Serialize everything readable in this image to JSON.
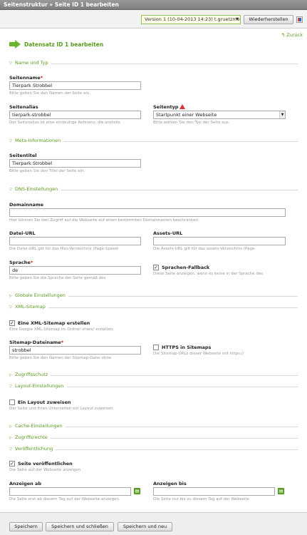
{
  "window": {
    "title": "Seitenstruktur » Seite ID 1 bearbeiten"
  },
  "toolbar": {
    "version_value": "Version 1 (10-04-2013 14:23) t.gruetzmer",
    "restore_label": "Wiederherstellen",
    "compare_icon": "diff-icon"
  },
  "back_label": "Zurück",
  "page_heading": "Datensatz ID 1 bearbeiten",
  "sections": {
    "name_typ": "Name und Typ",
    "meta": "Meta-Informationen",
    "dns": "DNS-Einstellungen",
    "global": "Globale Einstellungen",
    "xml": "XML-Sitemap",
    "zugriffsschutz": "Zugriffsschutz",
    "layout": "Layout-Einstellungen",
    "cache": "Cache-Einstellungen",
    "zugriffsrechte": "Zugriffsrechte",
    "veroeffentlichung": "Veröffentlichung"
  },
  "fields": {
    "seitenname": {
      "label": "Seitenname",
      "value": "Tierpark Strobbel",
      "hint": "Bitte geben Sie den Namen der Seite ein."
    },
    "seitenalias": {
      "label": "Seitenalias",
      "value": "tierpark-strobbel",
      "hint": "Der Seitenalias ist eine eindeutige Referenz, die anstelle"
    },
    "seitentyp": {
      "label": "Seitentyp",
      "value": "Startpunkt einer Webseite",
      "hint": "Bitte wählen Sie den Typ der Seite aus."
    },
    "seitentitel": {
      "label": "Seitentitel",
      "value": "Tierpark Strobbel",
      "hint": "Bitte geben Sie den Titel der Seite ein."
    },
    "domainname": {
      "label": "Domainname",
      "value": "",
      "hint": "Hier können Sie den Zugriff auf die Webseite auf einen bestimmten Domainnamen beschränken."
    },
    "datei_url": {
      "label": "Datei-URL",
      "value": "",
      "hint": "Die Datei-URL gilt für das files-Verzeichnis (Page-Speed-"
    },
    "assets_url": {
      "label": "Assets-URL",
      "value": "",
      "hint": "Die Assets-URL gilt für das assets-Verzeichnis (Page-"
    },
    "sprache": {
      "label": "Sprache",
      "value": "de",
      "hint": "Bitte geben Sie die Sprache der Seite gemäß des"
    },
    "sprachen_fallback": {
      "label": "Sprachen-Fallback",
      "checked": true,
      "hint": "Diese Seite anzeigen, wenn es keine in der Sprache des"
    },
    "xml_sitemap": {
      "label": "Eine XML-Sitemap erstellen",
      "checked": true,
      "hint": "Eine Google XML-Sitemap im Ordner share/ erstellen."
    },
    "sitemap_name": {
      "label": "Sitemap-Dateiname",
      "value": "strobbel",
      "hint": "Bitte geben Sie den Namen der Sitemap-Datei ohne"
    },
    "https_sitemap": {
      "label": "HTTPS in Sitemaps",
      "checked": false,
      "hint": "Die Sitemap-URLs dieser Webseite mit https://"
    },
    "layout_zuweisen": {
      "label": "Ein Layout zuweisen",
      "checked": false,
      "hint": "Der Seite und ihren Unterseiten ein Layout zuweisen."
    },
    "seite_veroeffentlichen": {
      "label": "Seite veröffentlichen",
      "checked": true,
      "hint": "Die Seite auf der Webseite anzeigen."
    },
    "anzeigen_ab": {
      "label": "Anzeigen ab",
      "value": "",
      "hint": "Die Seite erst ab diesem Tag auf der Webseite anzeigen."
    },
    "anzeigen_bis": {
      "label": "Anzeigen bis",
      "value": "",
      "hint": "Die Seite nur bis zu diesem Tag auf der Webseite"
    }
  },
  "footer": {
    "save": "Speichern",
    "save_close": "Speichern und schließen",
    "save_new": "Speichern und neu"
  },
  "colors": {
    "accent": "#5a9a1e",
    "required": "#dd0000",
    "titlebar": "#8a8a8a"
  }
}
